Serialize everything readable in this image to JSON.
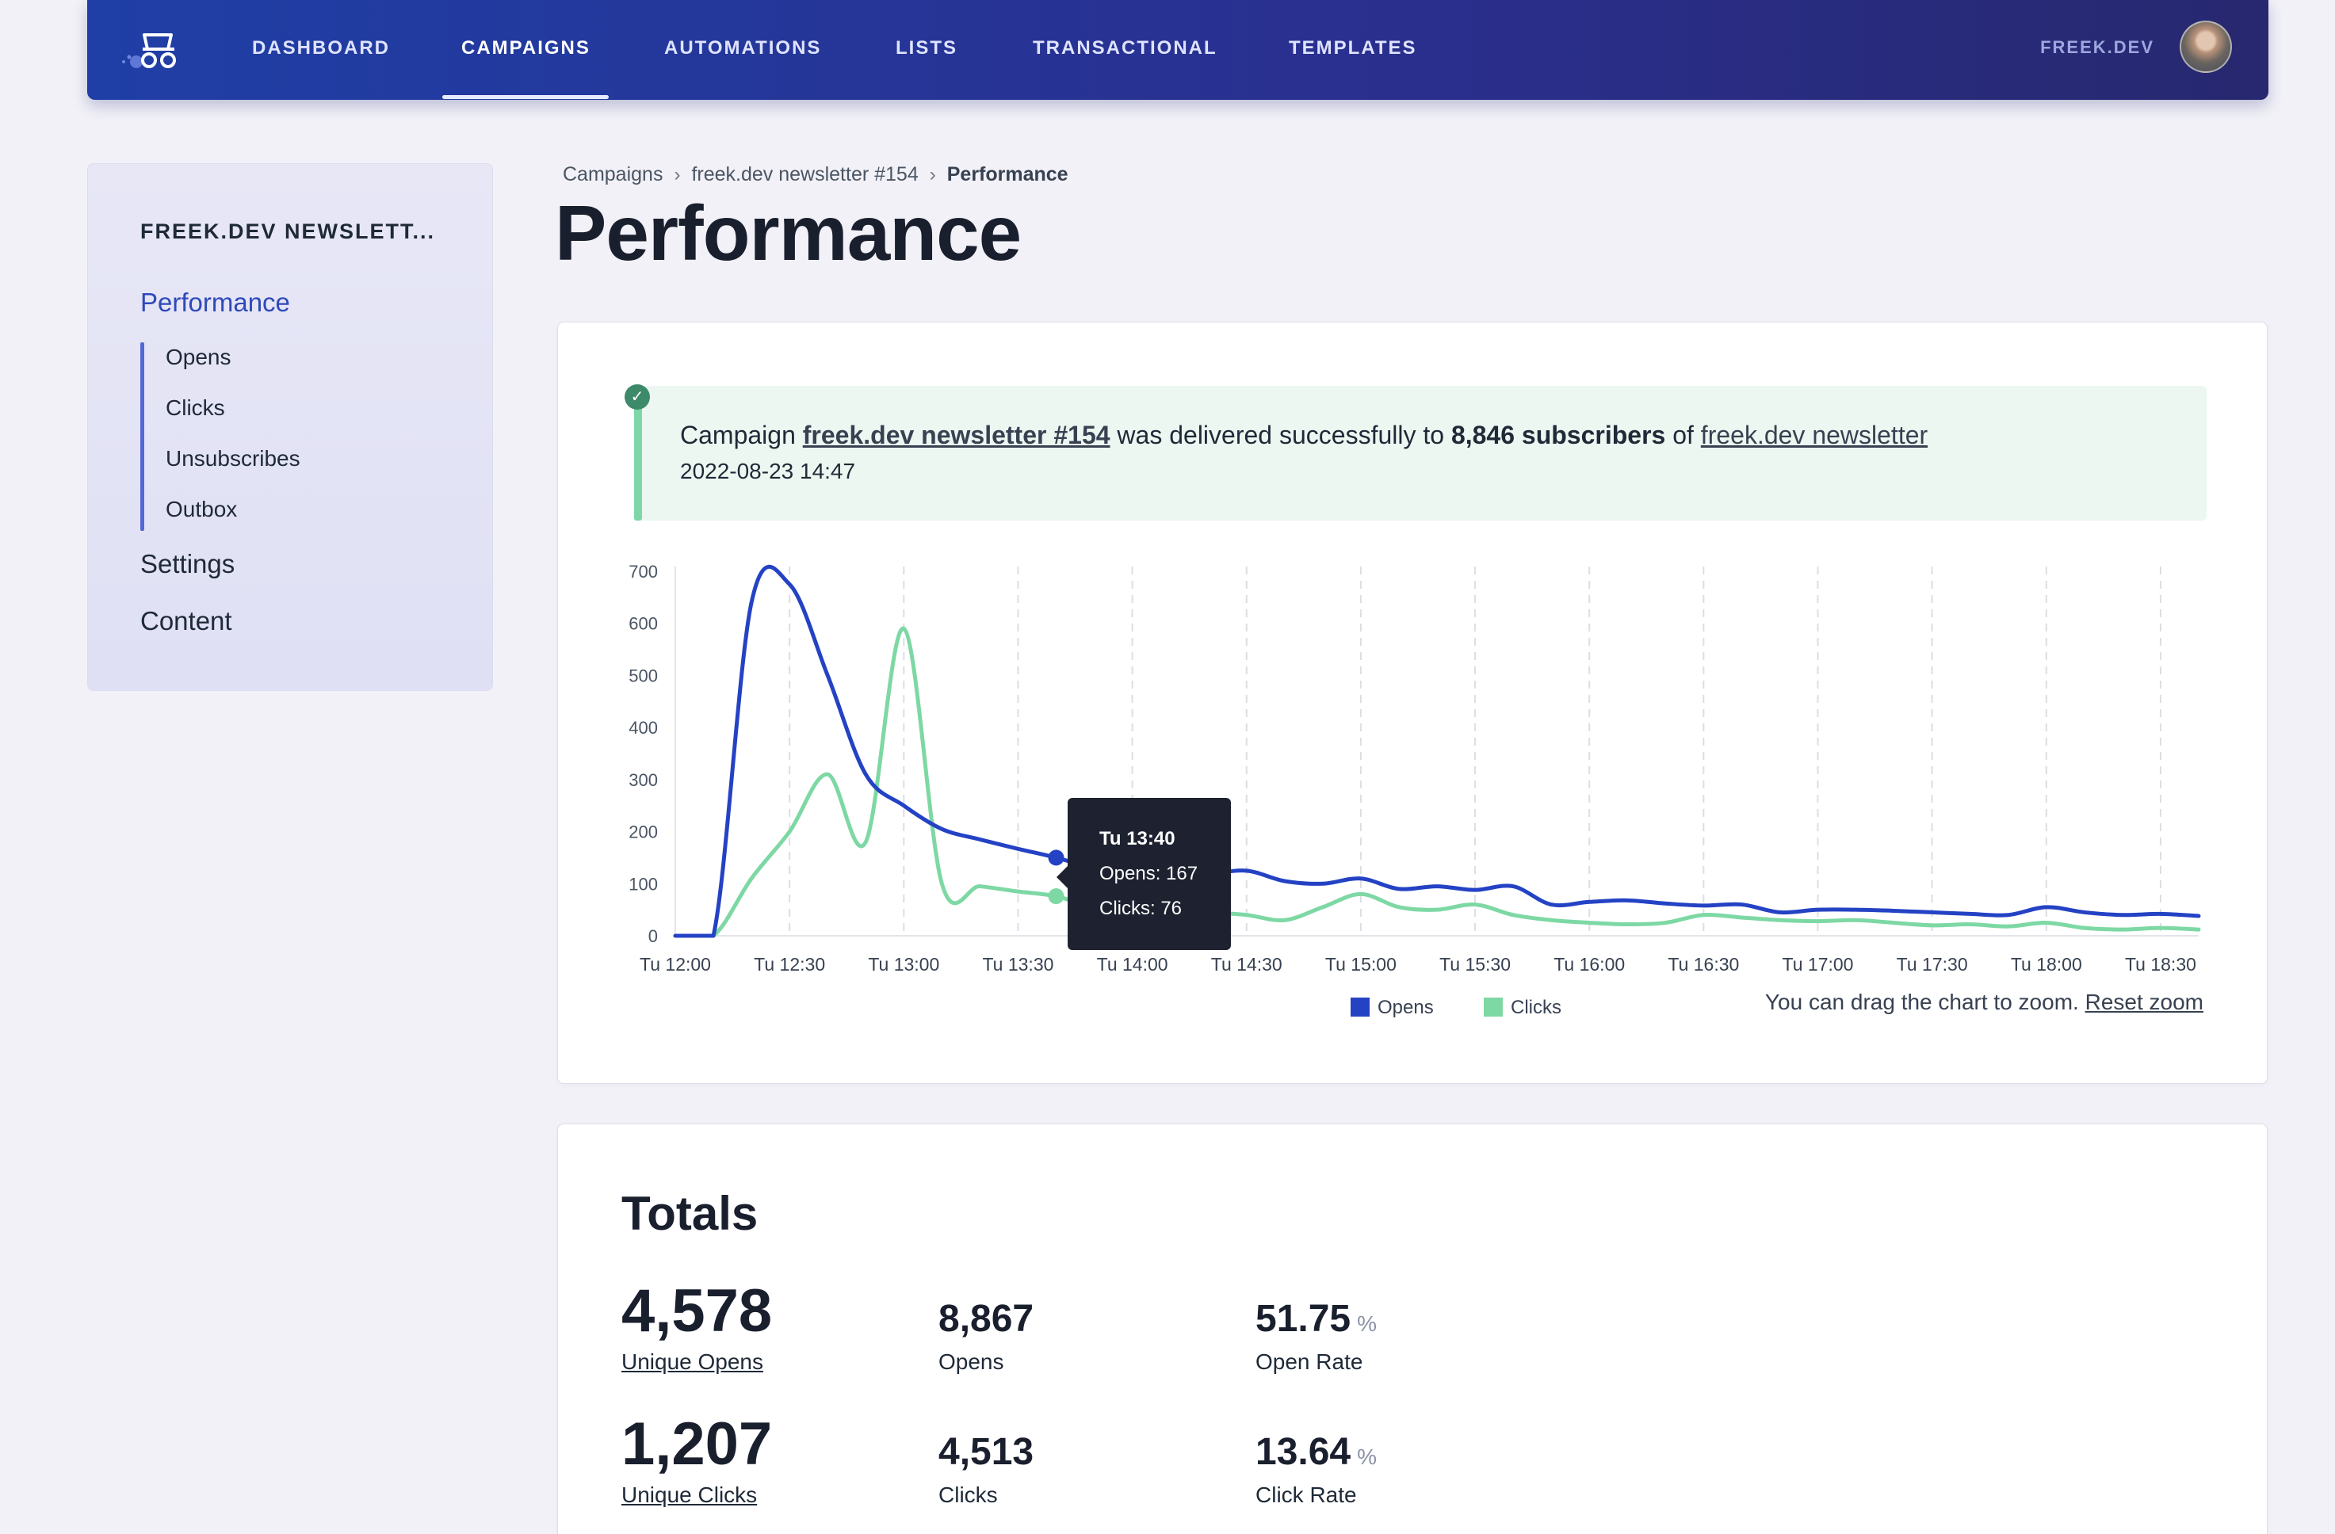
{
  "nav": {
    "items": [
      {
        "label": "DASHBOARD"
      },
      {
        "label": "CAMPAIGNS"
      },
      {
        "label": "AUTOMATIONS"
      },
      {
        "label": "LISTS"
      },
      {
        "label": "TRANSACTIONAL"
      },
      {
        "label": "TEMPLATES"
      }
    ],
    "active": "CAMPAIGNS",
    "user": "FREEK.DEV"
  },
  "sidebar": {
    "title": "FREEK.DEV NEWSLETT...",
    "items": [
      {
        "label": "Performance",
        "active": true
      },
      {
        "label": "Settings"
      },
      {
        "label": "Content"
      }
    ],
    "subitems": [
      {
        "label": "Opens"
      },
      {
        "label": "Clicks"
      },
      {
        "label": "Unsubscribes"
      },
      {
        "label": "Outbox"
      }
    ]
  },
  "breadcrumb": {
    "items": [
      "Campaigns",
      "freek.dev newsletter #154",
      "Performance"
    ]
  },
  "page": {
    "title": "Performance"
  },
  "alert": {
    "prefix": "Campaign",
    "campaign": "freek.dev newsletter #154",
    "middle": "was delivered successfully to",
    "subscribers": "8,846 subscribers",
    "of": "of",
    "list": "freek.dev newsletter",
    "date": "2022-08-23 14:47"
  },
  "chart_data": {
    "type": "line",
    "x": [
      "Tu 12:00",
      "12:10",
      "Tu 12:20",
      "Tu 12:30",
      "12:40",
      "12:50",
      "Tu 13:00",
      "13:10",
      "13:20",
      "Tu 13:30",
      "13:40",
      "13:50",
      "Tu 14:00",
      "14:10",
      "14:20",
      "Tu 14:30",
      "14:40",
      "14:50",
      "Tu 15:00",
      "15:10",
      "15:20",
      "Tu 15:30",
      "15:40",
      "15:50",
      "Tu 16:00",
      "16:10",
      "16:20",
      "Tu 16:30",
      "16:40",
      "16:50",
      "Tu 17:00",
      "17:10",
      "17:20",
      "Tu 17:30",
      "17:40",
      "17:50",
      "Tu 18:00",
      "18:10",
      "18:20",
      "Tu 18:30",
      "18:40"
    ],
    "x_ticks": [
      "Tu 12:00",
      "Tu 12:30",
      "Tu 13:00",
      "Tu 13:30",
      "Tu 14:00",
      "Tu 14:30",
      "Tu 15:00",
      "Tu 15:30",
      "Tu 16:00",
      "Tu 16:30",
      "Tu 17:00",
      "Tu 17:30",
      "Tu 18:00",
      "Tu 18:30"
    ],
    "series": [
      {
        "name": "Opens",
        "color": "#2442c4",
        "values": [
          0,
          0,
          640,
          675,
          500,
          310,
          250,
          205,
          185,
          167,
          150,
          130,
          120,
          115,
          118,
          125,
          105,
          100,
          110,
          90,
          95,
          88,
          95,
          60,
          65,
          68,
          62,
          58,
          60,
          45,
          50,
          50,
          48,
          45,
          42,
          40,
          55,
          45,
          40,
          42,
          38
        ]
      },
      {
        "name": "Clicks",
        "color": "#7dd8a4",
        "values": [
          0,
          0,
          110,
          200,
          310,
          180,
          590,
          100,
          95,
          85,
          76,
          55,
          60,
          50,
          45,
          40,
          30,
          55,
          80,
          55,
          50,
          60,
          40,
          30,
          25,
          22,
          25,
          40,
          35,
          30,
          28,
          30,
          25,
          20,
          22,
          18,
          25,
          15,
          12,
          15,
          12
        ]
      }
    ],
    "ylim": [
      0,
      700
    ],
    "y_ticks": [
      0,
      100,
      200,
      300,
      400,
      500,
      600,
      700
    ],
    "legend": "bottom-center",
    "grid": "vertical dashed",
    "tooltip": {
      "title": "Tu 13:40",
      "opens": "Opens: 167",
      "clicks": "Clicks: 76",
      "index": 10
    }
  },
  "zoom_hint": {
    "text": "You can drag the chart to zoom.",
    "reset": "Reset zoom"
  },
  "totals": {
    "title": "Totals",
    "unique_opens": "4,578",
    "unique_opens_label": "Unique Opens",
    "opens": "8,867",
    "opens_label": "Opens",
    "open_rate": "51.75",
    "open_rate_unit": "%",
    "open_rate_label": "Open Rate",
    "unique_clicks": "1,207",
    "unique_clicks_label": "Unique Clicks",
    "clicks": "4,513",
    "clicks_label": "Clicks",
    "click_rate": "13.64",
    "click_rate_unit": "%",
    "click_rate_label": "Click Rate"
  }
}
